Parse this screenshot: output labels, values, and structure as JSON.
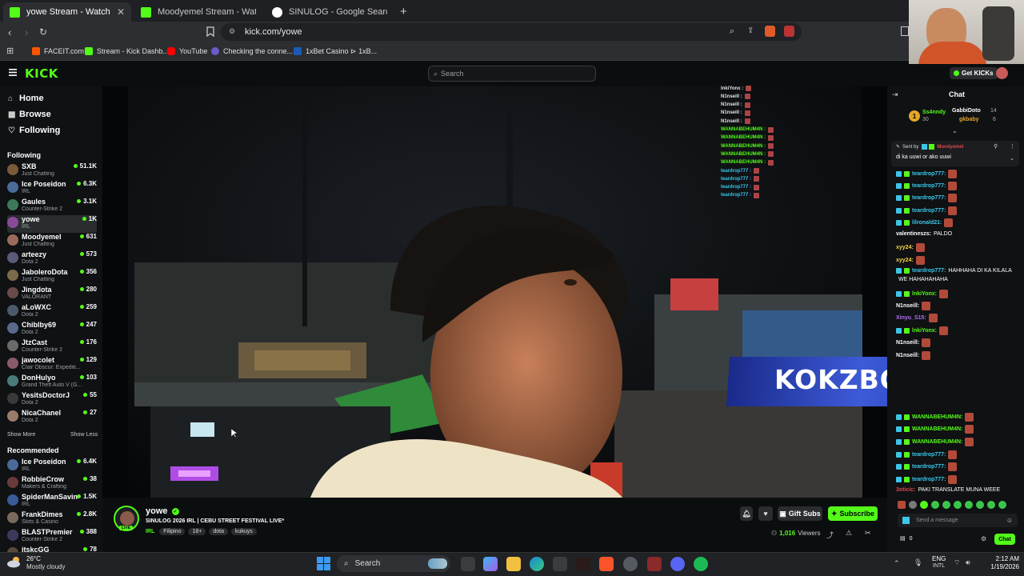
{
  "browser": {
    "tabs": [
      {
        "title": "yowe Stream - Watch Live on",
        "active": true
      },
      {
        "title": "Moodyemel Stream - Watch Live on",
        "active": false
      },
      {
        "title": "SINULOG - Google Search",
        "active": false
      }
    ],
    "url": "kick.com/yowe",
    "bookmarks": [
      "FACEIT.com",
      "Stream - Kick Dashb...",
      "YouTube",
      "Checking the conne...",
      "1xBet Casino ⊳ 1xB..."
    ]
  },
  "header": {
    "logo": "KICK",
    "search_placeholder": "Search",
    "get_kicks": "Get KICKs"
  },
  "sidebar": {
    "nav": [
      {
        "label": "Home",
        "icon": "home-icon"
      },
      {
        "label": "Browse",
        "icon": "browse-icon"
      },
      {
        "label": "Following",
        "icon": "heart-icon"
      }
    ],
    "following_title": "Following",
    "following": [
      {
        "name": "SXB",
        "category": "Just Chatting",
        "viewers": "51.1K",
        "color": "#7a5a3a"
      },
      {
        "name": "Ice Poseidon",
        "category": "IRL",
        "viewers": "6.3K",
        "color": "#4a6a9a"
      },
      {
        "name": "Gaules",
        "category": "Counter-Strike 2",
        "viewers": "3.1K",
        "color": "#3a7a5a"
      },
      {
        "name": "yowe",
        "category": "IRL",
        "viewers": "1K",
        "color": "#8a4a9a"
      },
      {
        "name": "Moodyemel",
        "category": "Just Chatting",
        "viewers": "631",
        "color": "#9a6a5a"
      },
      {
        "name": "arteezy",
        "category": "Dota 2",
        "viewers": "573",
        "color": "#5a5a7a"
      },
      {
        "name": "JaboleroDota",
        "category": "Just Chatting",
        "viewers": "356",
        "color": "#7a6a4a"
      },
      {
        "name": "Jingdota",
        "category": "VALORANT",
        "viewers": "280",
        "color": "#6a4a4a"
      },
      {
        "name": "aLoWXC",
        "category": "Dota 2",
        "viewers": "259",
        "color": "#4a5a6a"
      },
      {
        "name": "Chiblby69",
        "category": "Dota 2",
        "viewers": "247",
        "color": "#5a6a8a"
      },
      {
        "name": "JtzCast",
        "category": "Counter-Strike 2",
        "viewers": "176",
        "color": "#6a6a6a"
      },
      {
        "name": "jawocolet",
        "category": "Clair Obscur: Expediti...",
        "viewers": "129",
        "color": "#8a5a6a"
      },
      {
        "name": "DonHulyo",
        "category": "Grand Theft Auto V (G...",
        "viewers": "103",
        "color": "#4a7a7a"
      },
      {
        "name": "YesitsDoctorJ",
        "category": "Dota 2",
        "viewers": "55",
        "color": "#3a3a3a"
      },
      {
        "name": "NicaChanel",
        "category": "Dota 2",
        "viewers": "27",
        "color": "#9a7a6a"
      }
    ],
    "show_more": "Show More",
    "show_less": "Show Less",
    "recommended_title": "Recommended",
    "recommended": [
      {
        "name": "Ice Poseidon",
        "category": "IRL",
        "viewers": "6.4K",
        "color": "#4a6a9a"
      },
      {
        "name": "RobbieCrow",
        "category": "Makers & Crafting",
        "viewers": "38",
        "color": "#6a3a3a"
      },
      {
        "name": "SpiderManSaving...",
        "category": "IRL",
        "viewers": "1.5K",
        "color": "#3a5a9a"
      },
      {
        "name": "FrankDimes",
        "category": "Slots & Casino",
        "viewers": "2.8K",
        "color": "#7a6a5a"
      },
      {
        "name": "BLASTPremier",
        "category": "Counter-Strike 2",
        "viewers": "388",
        "color": "#3a3a5a"
      },
      {
        "name": "itskcGG",
        "category": "",
        "viewers": "78",
        "color": "#5a4a3a"
      }
    ]
  },
  "stream": {
    "channel": "yowe",
    "title": "SINULOG 2026 IRL | CEBU STREET FESTIVAL LIVE*",
    "category": "IRL",
    "tags": [
      "Filipino",
      "18+",
      "dota",
      "kukuys"
    ],
    "live_badge": "LIVE",
    "viewers": "1,016",
    "viewers_label": "Viewers",
    "gift_subs": "Gift Subs",
    "subscribe": "Subscribe",
    "overlay_banner": "KOKZBONUS",
    "overlay_feed": [
      "lnkiYonx :",
      "N1nseill :",
      "N1nseill :",
      "N1nseill :",
      "N1nseill :",
      "WANNABEHUM4N :",
      "WANNABEHUM4N :",
      "WANNABEHUM4N :",
      "WANNABEHUM4N :",
      "WANNABEHUM4N :",
      "teardrop777 :",
      "teardrop777 :",
      "teardrop777 :",
      "teardrop777 :"
    ]
  },
  "chat": {
    "title": "Chat",
    "leaders": [
      {
        "name": "Ss4nndy",
        "count": "30"
      },
      {
        "name": "GabbiDoto",
        "count": "14"
      },
      {
        "name": "gkbaby",
        "count": "6"
      }
    ],
    "pinned_by_label": "Sent by",
    "pinned_by": "Moodyemel",
    "pinned_text": "di ka uuwi or ako uuwi",
    "messages": [
      {
        "user": "teardrop777:",
        "text": "",
        "color": "#3bc6ea"
      },
      {
        "user": "teardrop777:",
        "text": "",
        "color": "#3bc6ea"
      },
      {
        "user": "teardrop777:",
        "text": "",
        "color": "#3bc6ea"
      },
      {
        "user": "teardrop777:",
        "text": "",
        "color": "#3bc6ea"
      },
      {
        "user": "lilronald21:",
        "text": "",
        "color": "#3bc6ea"
      },
      {
        "user": "valentineszs:",
        "text": "PALDO",
        "color": "#ffffff"
      },
      {
        "user": "xyy24:",
        "text": "",
        "color": "#f5d547"
      },
      {
        "user": "xyy24:",
        "text": "",
        "color": "#f5d547"
      },
      {
        "user": "teardrop777:",
        "text": "HAHHAHA DI KA KILALA",
        "color": "#3bc6ea"
      },
      {
        "user": "",
        "text": "WE HAHAHAHAHA",
        "color": "#ffffff"
      },
      {
        "user": "lnkiYonx:",
        "text": "",
        "color": "#53fc18"
      },
      {
        "user": "N1nseill:",
        "text": "",
        "color": "#ffffff"
      },
      {
        "user": "Xinyu_S15:",
        "text": "",
        "color": "#b06df2"
      },
      {
        "user": "lnkiYonx:",
        "text": "",
        "color": "#53fc18"
      },
      {
        "user": "N1nseill:",
        "text": "",
        "color": "#ffffff"
      },
      {
        "user": "N1nseill:",
        "text": "",
        "color": "#ffffff"
      },
      {
        "user": "WANNABEHUM4N:",
        "text": "",
        "color": "#53fc18"
      },
      {
        "user": "WANNABEHUM4N:",
        "text": "",
        "color": "#53fc18"
      },
      {
        "user": "WANNABEHUM4N:",
        "text": "",
        "color": "#53fc18"
      },
      {
        "user": "teardrop777:",
        "text": "",
        "color": "#3bc6ea"
      },
      {
        "user": "teardrop777:",
        "text": "",
        "color": "#3bc6ea"
      },
      {
        "user": "teardrop777:",
        "text": "",
        "color": "#3bc6ea"
      },
      {
        "user": "3oticic:",
        "text": "PAKI TRANSLATE MUNA WEEE",
        "color": "#e0454b"
      }
    ],
    "input_placeholder": "Send a message",
    "kicks_count": "0",
    "chat_button": "Chat"
  },
  "taskbar": {
    "weather_temp": "26°C",
    "weather_text": "Mostly cloudy",
    "search": "Search",
    "lang": "ENG",
    "lang_sub": "INTL",
    "time": "2:12 AM",
    "date": "1/19/2026"
  },
  "colors": {
    "kick_green": "#53fc18",
    "bg": "#0b0e0f",
    "panel": "#0f1113"
  }
}
